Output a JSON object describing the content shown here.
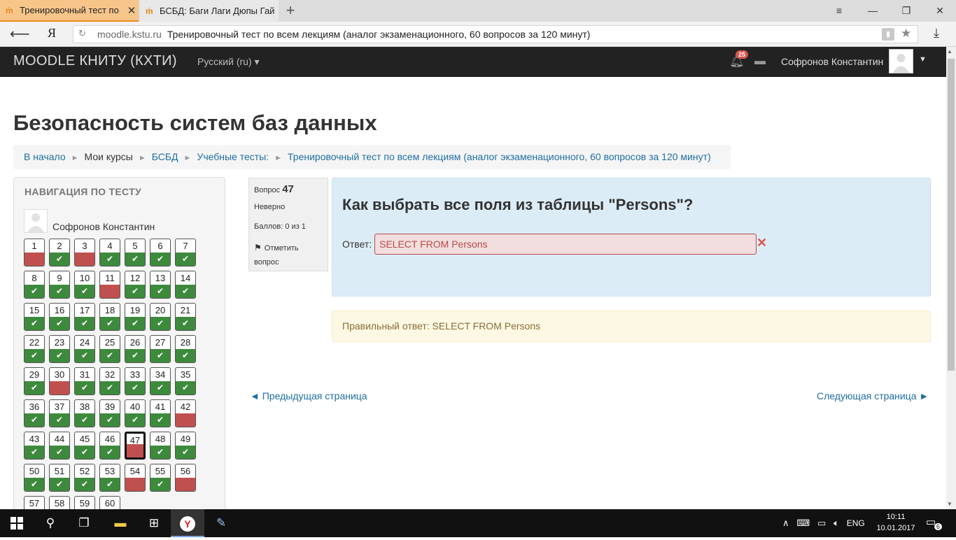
{
  "browser": {
    "tabs": [
      {
        "title": "Тренировочный тест по",
        "active": true
      },
      {
        "title": "БСБД: Баги Лаги Дюпы Гай",
        "active": false
      }
    ],
    "url_host": "moodle.kstu.ru",
    "url_title": "Тренировочный тест по всем лекциям (аналог экзаменационного, 60 вопросов за 120 минут)",
    "yandex_label": "Я"
  },
  "navbar": {
    "brand": "MOODLE КНИТУ (КХТИ)",
    "language": "Русский (ru)",
    "notifications_count": "25",
    "username": "Софронов Константин"
  },
  "page": {
    "title": "Безопасность систем баз данных",
    "breadcrumb": [
      "В начало",
      "Мои курсы",
      "БСБД",
      "Учебные тесты:",
      "Тренировочный тест по всем лекциям (аналог экзаменационного, 60 вопросов за 120 минут)"
    ]
  },
  "quiz_nav": {
    "title": "НАВИГАЦИЯ ПО ТЕСТУ",
    "user": "Софронов Константин",
    "current": 47,
    "questions": [
      {
        "n": "1",
        "s": "bad"
      },
      {
        "n": "2",
        "s": "ok"
      },
      {
        "n": "3",
        "s": "bad"
      },
      {
        "n": "4",
        "s": "ok"
      },
      {
        "n": "5",
        "s": "ok"
      },
      {
        "n": "6",
        "s": "ok"
      },
      {
        "n": "7",
        "s": "ok"
      },
      {
        "n": "8",
        "s": "ok"
      },
      {
        "n": "9",
        "s": "ok"
      },
      {
        "n": "10",
        "s": "ok"
      },
      {
        "n": "11",
        "s": "bad"
      },
      {
        "n": "12",
        "s": "ok"
      },
      {
        "n": "13",
        "s": "ok"
      },
      {
        "n": "14",
        "s": "ok"
      },
      {
        "n": "15",
        "s": "ok"
      },
      {
        "n": "16",
        "s": "ok"
      },
      {
        "n": "17",
        "s": "ok"
      },
      {
        "n": "18",
        "s": "ok"
      },
      {
        "n": "19",
        "s": "ok"
      },
      {
        "n": "20",
        "s": "ok"
      },
      {
        "n": "21",
        "s": "ok"
      },
      {
        "n": "22",
        "s": "ok"
      },
      {
        "n": "23",
        "s": "ok"
      },
      {
        "n": "24",
        "s": "ok"
      },
      {
        "n": "25",
        "s": "ok"
      },
      {
        "n": "26",
        "s": "ok"
      },
      {
        "n": "27",
        "s": "ok"
      },
      {
        "n": "28",
        "s": "ok"
      },
      {
        "n": "29",
        "s": "ok"
      },
      {
        "n": "30",
        "s": "bad"
      },
      {
        "n": "31",
        "s": "ok"
      },
      {
        "n": "32",
        "s": "ok"
      },
      {
        "n": "33",
        "s": "ok"
      },
      {
        "n": "34",
        "s": "ok"
      },
      {
        "n": "35",
        "s": "ok"
      },
      {
        "n": "36",
        "s": "ok"
      },
      {
        "n": "37",
        "s": "ok"
      },
      {
        "n": "38",
        "s": "ok"
      },
      {
        "n": "39",
        "s": "ok"
      },
      {
        "n": "40",
        "s": "ok"
      },
      {
        "n": "41",
        "s": "ok"
      },
      {
        "n": "42",
        "s": "bad"
      },
      {
        "n": "43",
        "s": "ok"
      },
      {
        "n": "44",
        "s": "ok"
      },
      {
        "n": "45",
        "s": "ok"
      },
      {
        "n": "46",
        "s": "ok"
      },
      {
        "n": "47",
        "s": "bad"
      },
      {
        "n": "48",
        "s": "ok"
      },
      {
        "n": "49",
        "s": "ok"
      },
      {
        "n": "50",
        "s": "ok"
      },
      {
        "n": "51",
        "s": "ok"
      },
      {
        "n": "52",
        "s": "ok"
      },
      {
        "n": "53",
        "s": "ok"
      },
      {
        "n": "54",
        "s": "bad"
      },
      {
        "n": "55",
        "s": "ok"
      },
      {
        "n": "56",
        "s": "bad"
      },
      {
        "n": "57",
        "s": "none"
      },
      {
        "n": "58",
        "s": "none"
      },
      {
        "n": "59",
        "s": "none"
      },
      {
        "n": "60",
        "s": "none"
      }
    ]
  },
  "question": {
    "label": "Вопрос",
    "number": "47",
    "state": "Неверно",
    "grade": "Баллов: 0 из 1",
    "flag_label": "Отметить вопрос",
    "text": "Как выбрать все поля из таблицы \"Persons\"?",
    "answer_label": "Ответ:",
    "answer_value": "SELECT FROM Persons",
    "right_answer": "Правильный ответ: SELECT FROM Persons",
    "prev_page": "◄ Предыдущая страница",
    "next_page": "Следующая страница ►"
  },
  "colors": {
    "correct": "#3d8a3d",
    "incorrect": "#c0504f",
    "link": "#1f6ea3",
    "question_bg": "#dcecf6",
    "feedback_bg": "#fcf8e3"
  },
  "taskbar": {
    "language": "ENG",
    "time": "10:11",
    "date": "10.01.2017",
    "notifications": "6"
  }
}
